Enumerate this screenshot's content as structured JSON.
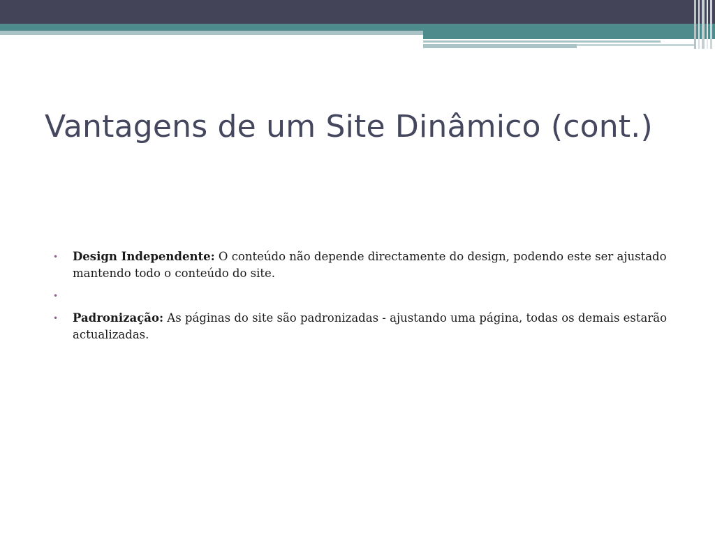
{
  "slide": {
    "title": "Vantagens de um Site Dinâmico (cont.)",
    "bullet_glyph": "•",
    "items": [
      {
        "term": "Design Independente:",
        "text": " O conteúdo não depende directamente do design, podendo este ser ajustado mantendo todo o conteúdo do site."
      },
      {
        "term": "",
        "text": ""
      },
      {
        "term": "Padronização:",
        "text": " As páginas do site são padronizadas - ajustando uma página, todas os demais estarão actualizadas."
      }
    ]
  },
  "colors": {
    "header_dark": "#434457",
    "header_teal": "#4e8b8d",
    "header_light": "#a9c3c6",
    "title_text": "#44475e",
    "bullet": "#8a5d86"
  }
}
